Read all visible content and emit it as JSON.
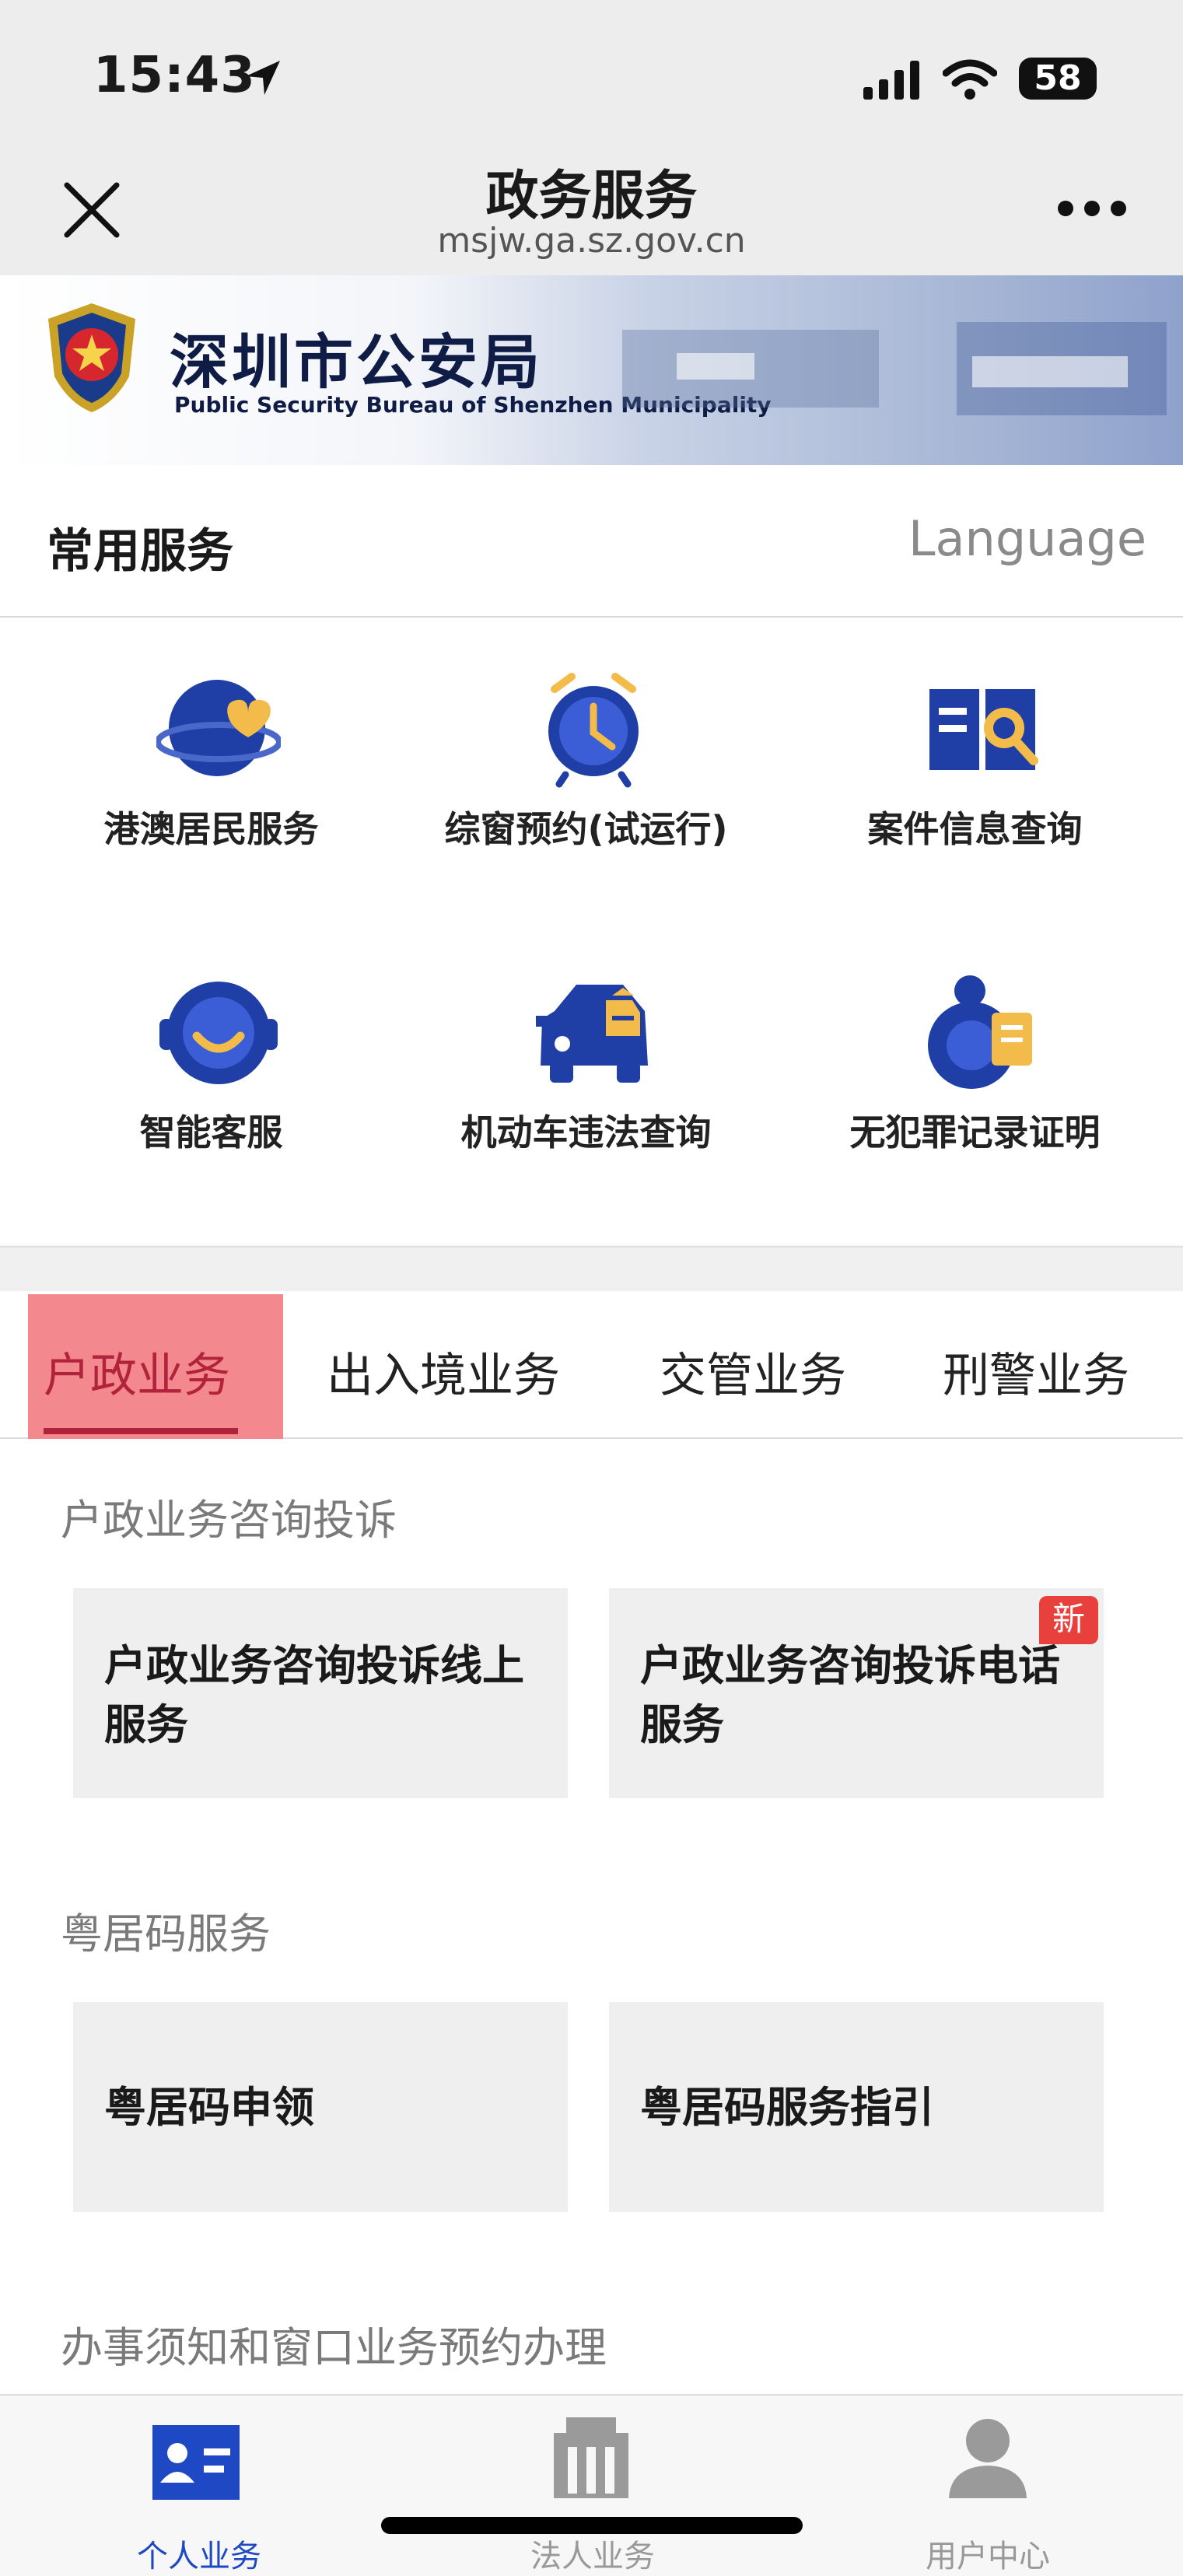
{
  "status_bar": {
    "time": "15:43",
    "battery": "58"
  },
  "nav": {
    "title": "政务服务",
    "subtitle": "msjw.ga.sz.gov.cn"
  },
  "banner": {
    "title": "深圳市公安局",
    "title_en": "Public Security Bureau of Shenzhen Municipality"
  },
  "common_services": {
    "title": "常用服务",
    "language_label": "Language",
    "items": [
      {
        "label": "港澳居民服务",
        "icon": "globe-heart-icon"
      },
      {
        "label": "综窗预约(试运行)",
        "icon": "alarm-clock-icon"
      },
      {
        "label": "案件信息查询",
        "icon": "document-search-icon"
      },
      {
        "label": "智能客服",
        "icon": "headset-smile-icon"
      },
      {
        "label": "机动车违法查询",
        "icon": "police-car-icon"
      },
      {
        "label": "无犯罪记录证明",
        "icon": "badge-certificate-icon"
      }
    ]
  },
  "tabs": [
    {
      "label": "户政业务",
      "active": true
    },
    {
      "label": "出入境业务",
      "active": false
    },
    {
      "label": "交管业务",
      "active": false
    },
    {
      "label": "刑警业务",
      "active": false
    }
  ],
  "groups": [
    {
      "title": "户政业务咨询投诉",
      "cards": [
        {
          "label": "户政业务咨询投诉线上服务",
          "badge": ""
        },
        {
          "label": "户政业务咨询投诉电话服务",
          "badge": "新"
        }
      ]
    },
    {
      "title": "粤居码服务",
      "cards": [
        {
          "label": "粤居码申领",
          "badge": ""
        },
        {
          "label": "粤居码服务指引",
          "badge": ""
        }
      ]
    },
    {
      "title": "办事须知和窗口业务预约办理",
      "cards": []
    }
  ],
  "bottom_nav": [
    {
      "label": "个人业务",
      "icon": "id-card-icon",
      "active": true
    },
    {
      "label": "法人业务",
      "icon": "building-icon",
      "active": false
    },
    {
      "label": "用户中心",
      "icon": "user-icon",
      "active": false
    }
  ],
  "colors": {
    "accent": "#1f49c4",
    "tab_active": "#b0233a",
    "tab_highlight": "#f4888f",
    "badge": "#e8413d"
  }
}
